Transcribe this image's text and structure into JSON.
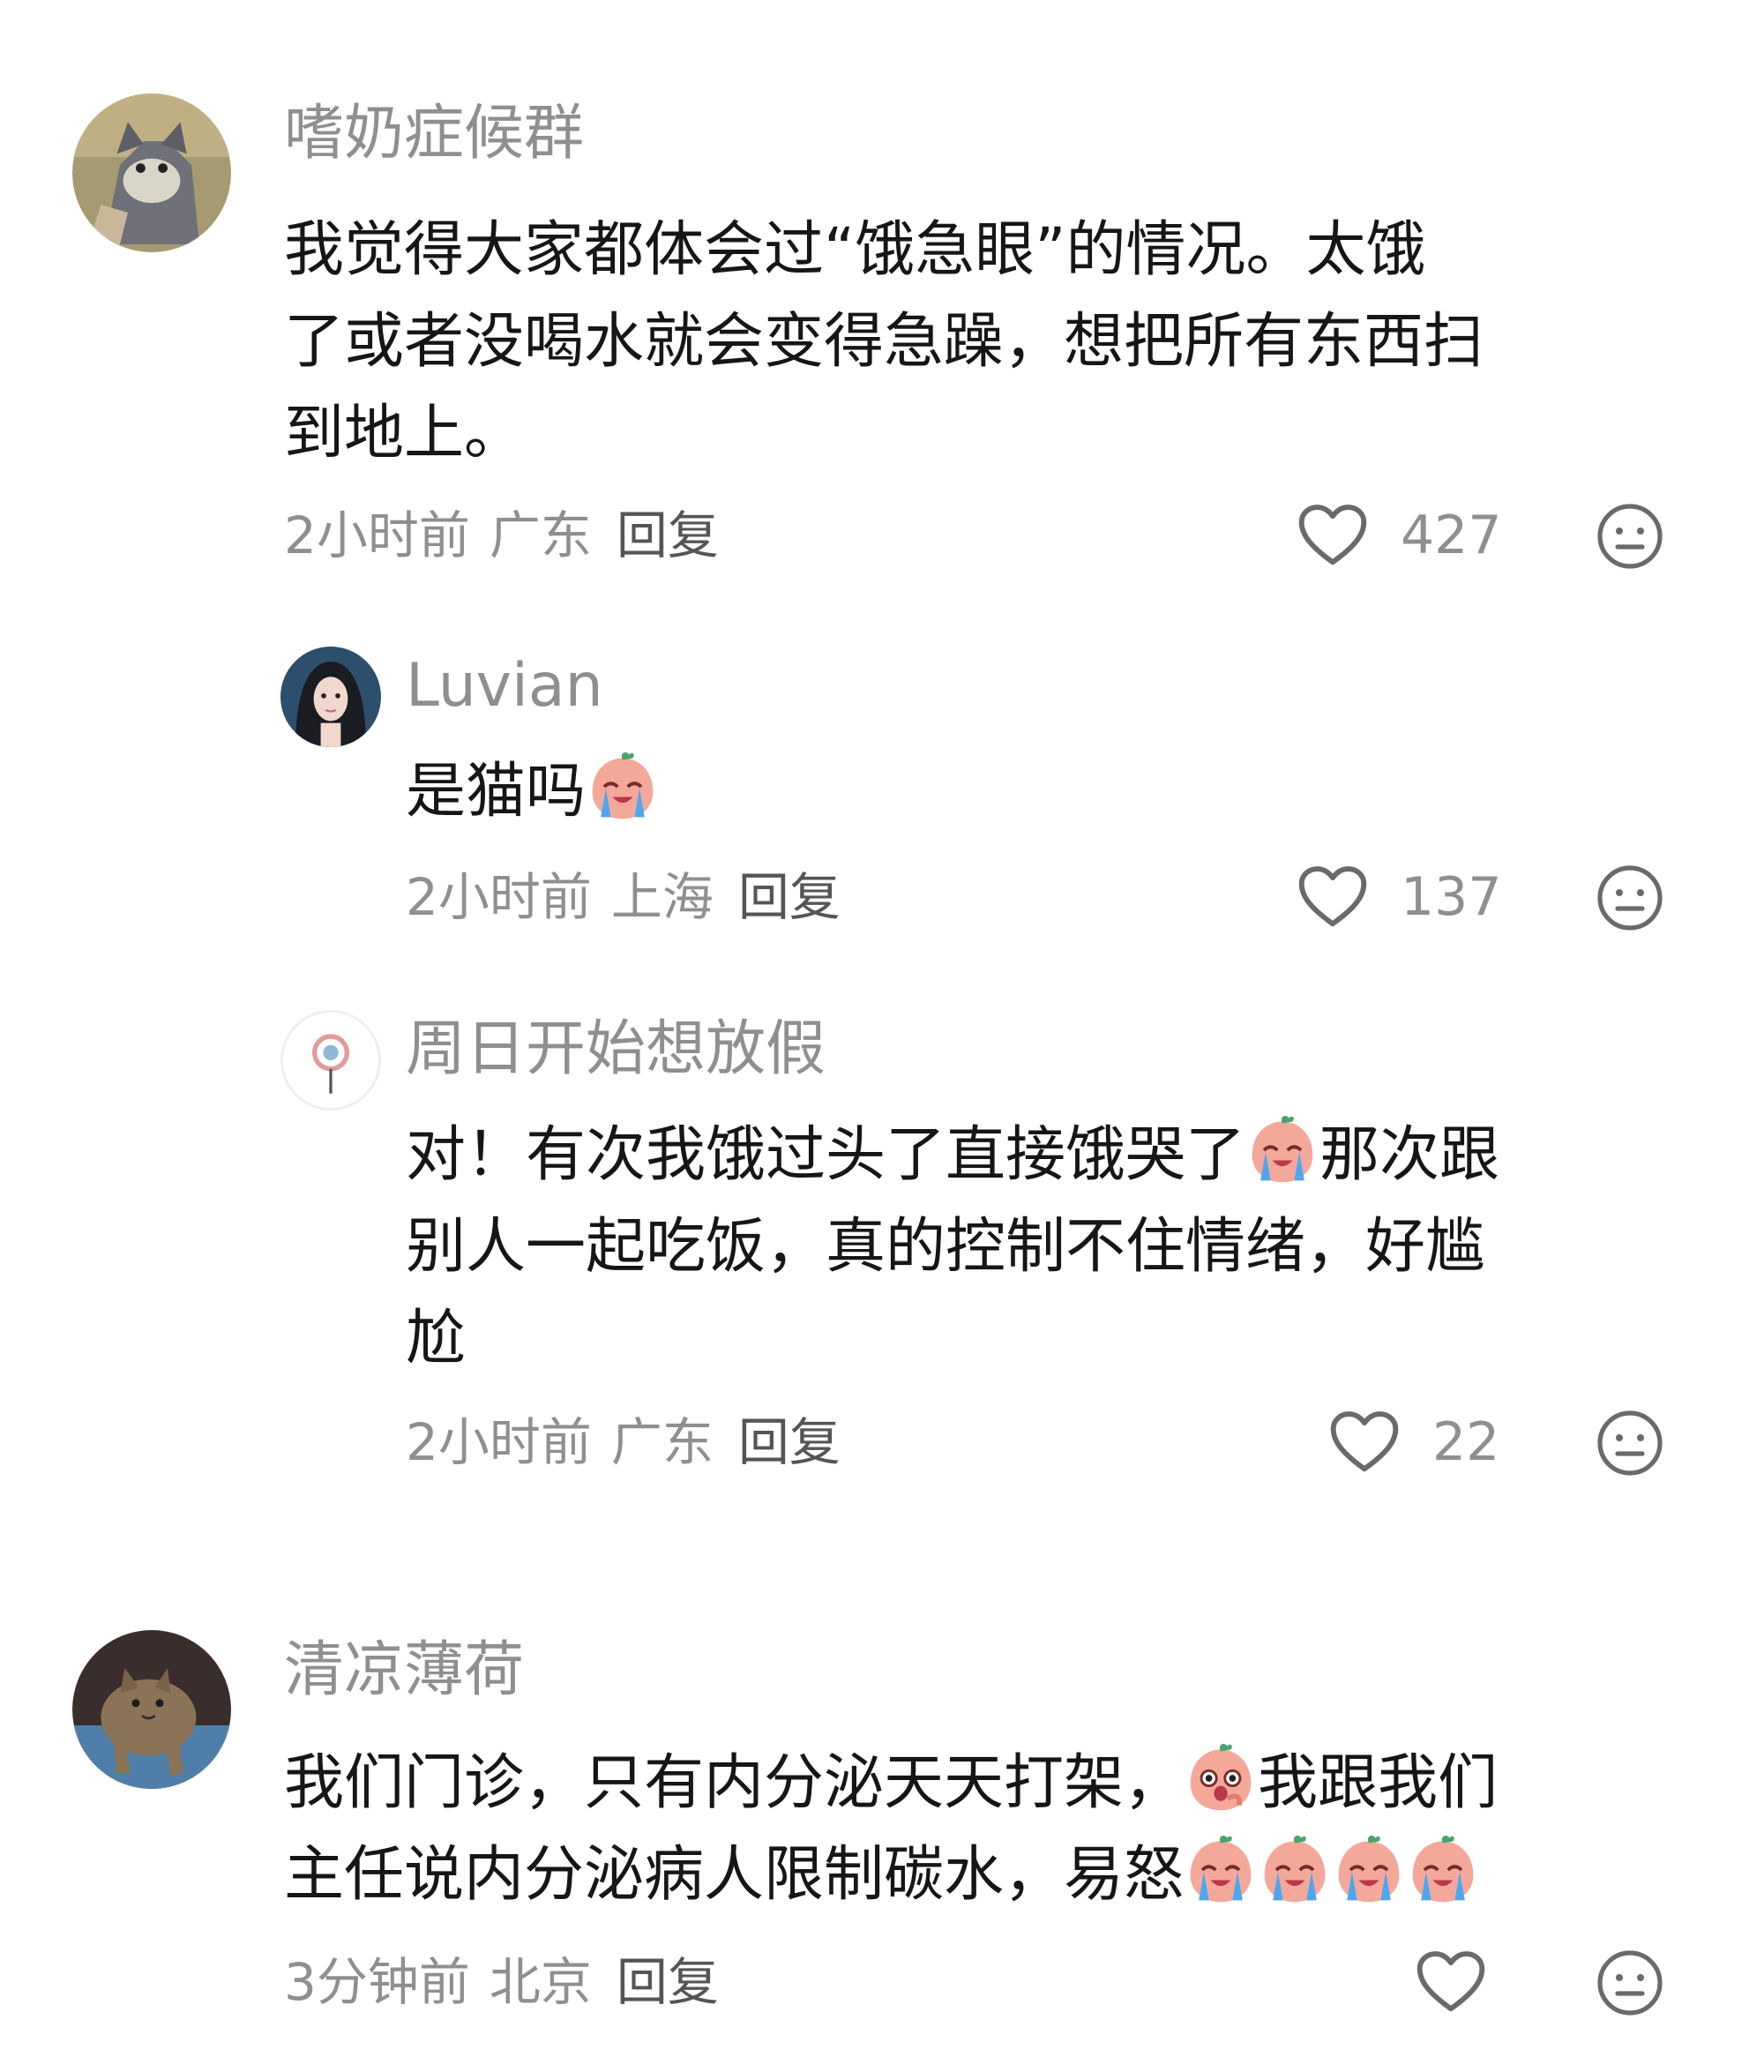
{
  "comments": [
    {
      "user": "嗜奶症候群",
      "text_line1": "我觉得大家都体会过“饿急眼”的情况。太饿",
      "text_line2": "了或者没喝水就会变得急躁，想把所有东西扫",
      "text_line3": "到地上。",
      "time": "2小时前",
      "location": "广东",
      "reply_label": "回复",
      "likes": "427",
      "replies": [
        {
          "user": "Luvian",
          "text": "是猫吗",
          "time": "2小时前",
          "location": "上海",
          "reply_label": "回复",
          "likes": "137"
        },
        {
          "user": "周日开始想放假",
          "text_line1_a": "对！有次我饿过头了直接饿哭了",
          "text_line1_b": "那次跟",
          "text_line2": "别人一起吃饭，真的控制不住情绪，好尴",
          "text_line3": "尬",
          "time": "2小时前",
          "location": "广东",
          "reply_label": "回复",
          "likes": "22"
        }
      ]
    },
    {
      "user": "清凉薄荷",
      "text_line1_a": "我们门诊，只有内分泌天天打架，",
      "text_line1_b": "我跟我们",
      "text_line2": "主任说内分泌病人限制碳水，易怒",
      "time": "3分钟前",
      "location": "北京",
      "reply_label": "回复",
      "likes": ""
    }
  ],
  "icons": {
    "like": "heart-outline-icon",
    "more": "neutral-face-icon",
    "emoji_crying": "crying-peach-emoji",
    "emoji_shocked": "shocked-peach-emoji"
  },
  "colors": {
    "username": "#8f8f8f",
    "text": "#161616",
    "meta": "#8f8f8f",
    "icon": "#6a6a6a"
  }
}
